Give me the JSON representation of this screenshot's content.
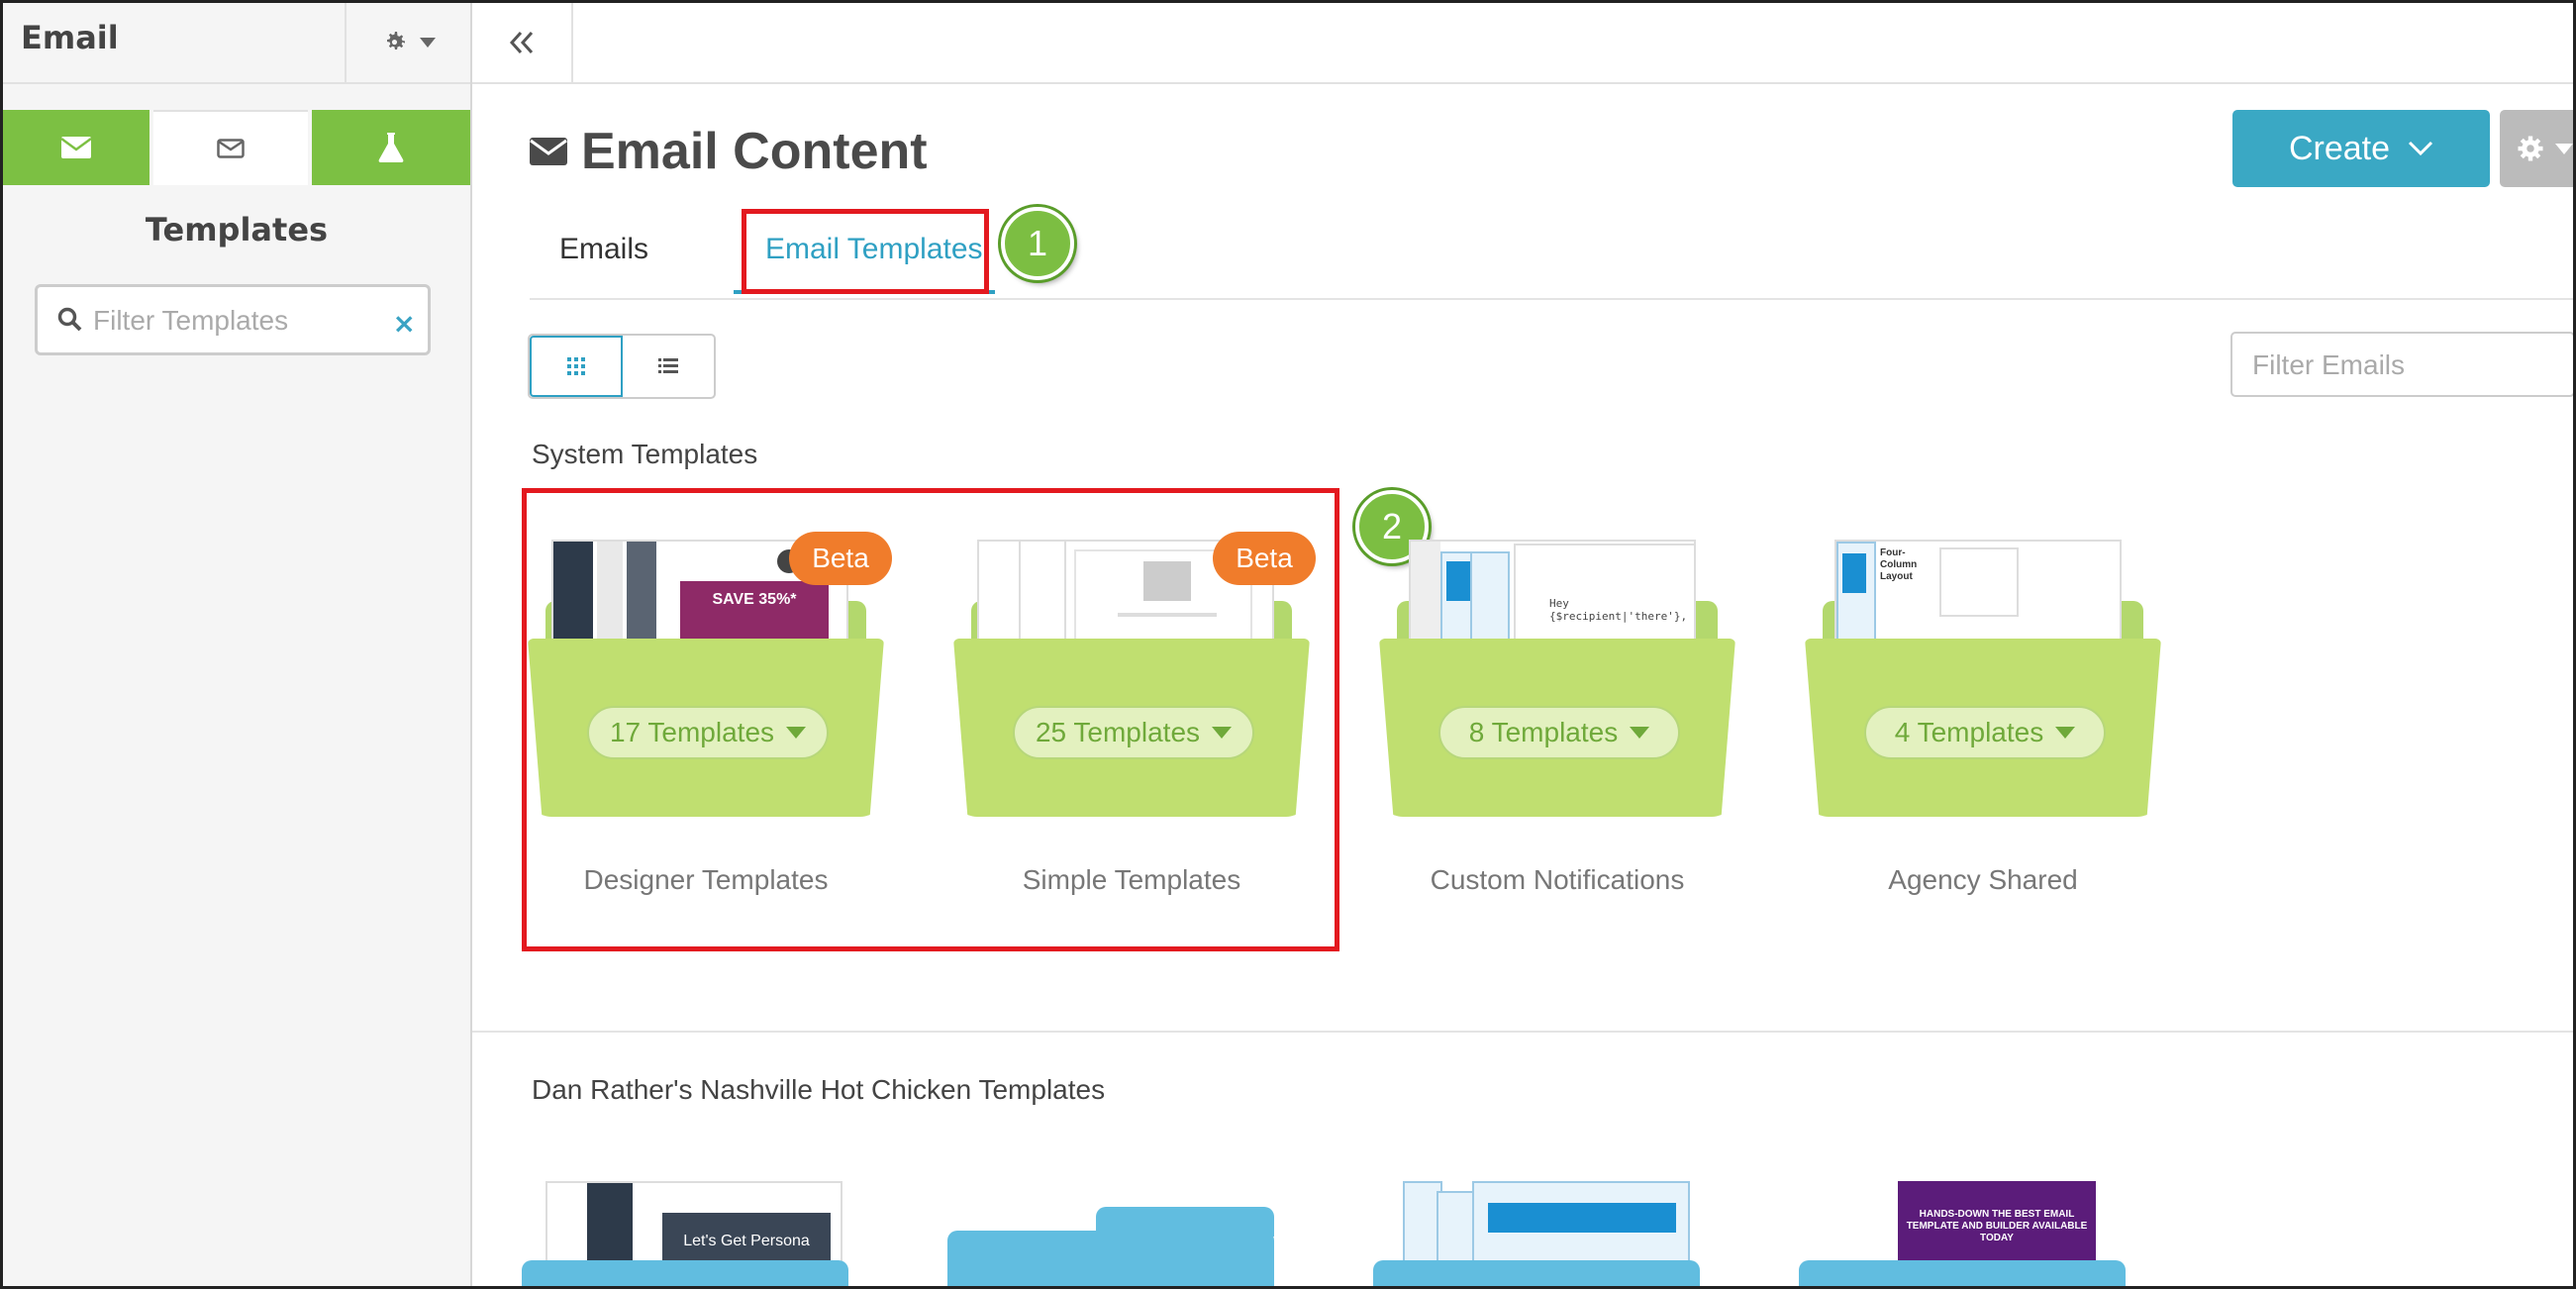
{
  "sidebar": {
    "title": "Email",
    "section_label": "Templates",
    "filter_placeholder": "Filter Templates",
    "clear_symbol": "×"
  },
  "header": {
    "page_title": "Email Content",
    "create_label": "Create"
  },
  "tabs": [
    {
      "label": "Emails",
      "active": false
    },
    {
      "label": "Email Templates",
      "active": true
    }
  ],
  "filter_emails_placeholder": "Filter Emails",
  "annotations": {
    "step1": "1",
    "step2": "2"
  },
  "system_section": {
    "title": "System Templates",
    "folders": [
      {
        "name": "Designer Templates",
        "count_label": "17 Templates",
        "badge": "Beta",
        "preview_text": "SAVE 35%*"
      },
      {
        "name": "Simple Templates",
        "count_label": "25 Templates",
        "badge": "Beta"
      },
      {
        "name": "Custom Notifications",
        "count_label": "8 Templates",
        "preview_text": "Hey {$recipient|'there'},"
      },
      {
        "name": "Agency Shared",
        "count_label": "4 Templates",
        "preview_text": "Four-Column Layout"
      }
    ]
  },
  "custom_section": {
    "title": "Dan Rather's Nashville Hot Chicken Templates",
    "previews": [
      "Let's Get Persona",
      "HANDS-DOWN THE BEST EMAIL TEMPLATE AND BUILDER AVAILABLE TODAY"
    ]
  },
  "colors": {
    "accent": "#3aa8c4",
    "sidebar_tab_green": "#7cc043",
    "folder_green": "#c0df70",
    "folder_blue": "#61bde0",
    "beta_orange": "#f07c2b",
    "annotation_red": "#e3191f"
  }
}
